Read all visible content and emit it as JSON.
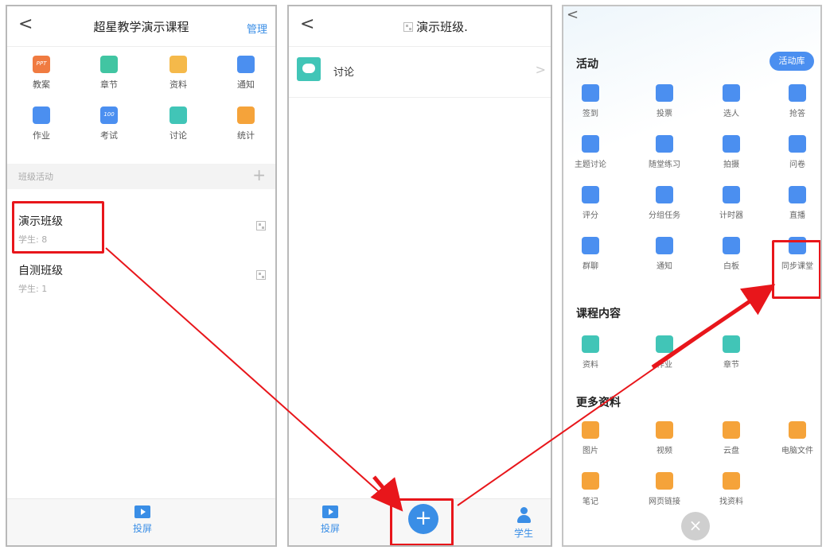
{
  "panel1": {
    "back_icon": "<",
    "title": "超星教学演示课程",
    "manage": "管理",
    "grid": [
      {
        "label": "教案",
        "icon": "ppt-icon",
        "badge": "PPT",
        "color": "#f07b41"
      },
      {
        "label": "章节",
        "icon": "list-icon",
        "color": "#41c5a2"
      },
      {
        "label": "资料",
        "icon": "folder-icon",
        "color": "#f5b94a"
      },
      {
        "label": "通知",
        "icon": "speaker-icon",
        "color": "#4b8ff0"
      },
      {
        "label": "作业",
        "icon": "pencil-doc-icon",
        "color": "#4b8ff0"
      },
      {
        "label": "考试",
        "icon": "score-icon",
        "badge": "100",
        "color": "#4b8ff0"
      },
      {
        "label": "讨论",
        "icon": "chat-icon",
        "color": "#41c5b7"
      },
      {
        "label": "统计",
        "icon": "pie-icon",
        "color": "#f5a33a"
      }
    ],
    "section_label": "班级活动",
    "section_plus": "+",
    "classes": [
      {
        "name": "演示班级",
        "students": "学生: 8"
      },
      {
        "name": "自测班级",
        "students": "学生: 1"
      }
    ],
    "screen_label": "投屏"
  },
  "panel2": {
    "back_icon": "<",
    "title": "演示班级.",
    "row_label": "讨论",
    "row_chevron": ">",
    "screen_label": "投屏",
    "fab": "+",
    "student_label": "学生"
  },
  "panel3": {
    "back_icon": "<",
    "activities_heading": "活动",
    "library_button": "活动库",
    "activities": [
      {
        "label": "签到",
        "icon": "tap-icon",
        "color": "#4b8ff0"
      },
      {
        "label": "投票",
        "icon": "bar-chart-icon",
        "color": "#4b8ff0"
      },
      {
        "label": "选人",
        "icon": "person-check-icon",
        "color": "#4b8ff0"
      },
      {
        "label": "抢答",
        "icon": "microphone-icon",
        "color": "#4b8ff0"
      },
      {
        "label": "主题讨论",
        "icon": "chat-icon",
        "color": "#4b8ff0"
      },
      {
        "label": "随堂练习",
        "icon": "quiz-icon",
        "color": "#4b8ff0"
      },
      {
        "label": "拍摄",
        "icon": "camera-icon",
        "color": "#4b8ff0"
      },
      {
        "label": "问卷",
        "icon": "question-icon",
        "color": "#4b8ff0"
      },
      {
        "label": "评分",
        "icon": "lotus-icon",
        "color": "#4b8ff0"
      },
      {
        "label": "分组任务",
        "icon": "checklist-icon",
        "color": "#4b8ff0"
      },
      {
        "label": "计时器",
        "icon": "timer-icon",
        "color": "#4b8ff0"
      },
      {
        "label": "直播",
        "icon": "play-icon",
        "color": "#4b8ff0"
      },
      {
        "label": "群聊",
        "icon": "group-chat-icon",
        "color": "#4b8ff0"
      },
      {
        "label": "通知",
        "icon": "speaker-icon",
        "color": "#4b8ff0"
      },
      {
        "label": "白板",
        "icon": "whiteboard-icon",
        "color": "#4b8ff0"
      },
      {
        "label": "同步课堂",
        "icon": "sync-class-icon",
        "color": "#4b8ff0"
      }
    ],
    "course_heading": "课程内容",
    "course": [
      {
        "label": "资料",
        "icon": "folder-icon",
        "color": "#41c5b7"
      },
      {
        "label": "作业",
        "icon": "pencil-doc-icon",
        "color": "#41c5b7"
      },
      {
        "label": "章节",
        "icon": "list-icon",
        "color": "#41c5b7"
      }
    ],
    "more_heading": "更多资料",
    "more": [
      {
        "label": "图片",
        "icon": "image-icon",
        "color": "#f5a33a"
      },
      {
        "label": "视频",
        "icon": "video-icon",
        "color": "#f5a33a"
      },
      {
        "label": "云盘",
        "icon": "cloud-icon",
        "color": "#f5a33a"
      },
      {
        "label": "电脑文件",
        "icon": "monitor-icon",
        "color": "#f5a33a"
      },
      {
        "label": "笔记",
        "icon": "note-icon",
        "color": "#f5a33a"
      },
      {
        "label": "网页链接",
        "icon": "link-icon",
        "color": "#f5a33a"
      },
      {
        "label": "找资料",
        "icon": "search-icon",
        "color": "#f5a33a"
      }
    ],
    "close": "×"
  },
  "colors": {
    "accent": "#3a8ee6",
    "highlight": "#e8161b"
  }
}
